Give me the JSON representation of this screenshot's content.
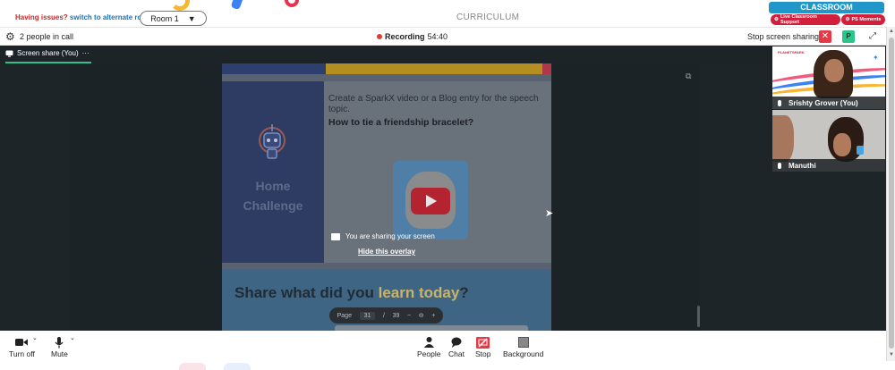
{
  "topbar": {
    "issues_text": "Having issues?",
    "switch_link": "switch to alternate room",
    "room_label": "Room 1",
    "room_arrow": "▼",
    "curriculum": "CURRICULUM",
    "classroom_badge": "CLASSROOM",
    "live_support": "Live Classroom Support",
    "ps_moments": "PS Moments"
  },
  "callbar": {
    "people_in_call": "2 people in call",
    "recording_label": "Recording",
    "recording_time": "54:40",
    "stop_sharing": "Stop screen sharing",
    "close_symbol": "✕",
    "p_badge": "P",
    "fullscreen_symbol": "⤢"
  },
  "stage": {
    "tab_label": "Screen share (You)",
    "tab_more": "···",
    "overlay_title": "You are sharing your screen",
    "overlay_hide": "Hide this overlay"
  },
  "shared_document": {
    "home_challenge_line1": "Home",
    "home_challenge_line2": "Challenge",
    "task_text": "Create a SparkX video or a Blog entry for the speech topic.",
    "question": "How to tie a friendship bracelet?",
    "share_prefix": "Share what did you ",
    "share_highlight": "learn today",
    "share_suffix": "?",
    "page_label": "Page",
    "page_current": "31",
    "page_sep": "/",
    "page_total": "39",
    "minus": "−",
    "zoom": "⊖",
    "plus": "+"
  },
  "participants": [
    {
      "name": "Srishty Grover (You)",
      "logo": "PLANETSPARK"
    },
    {
      "name": "Manuthi"
    }
  ],
  "toolbar": {
    "turn_off": "Turn off",
    "mute": "Mute",
    "people": "People",
    "chat": "Chat",
    "stop": "Stop",
    "background": "Background"
  },
  "colors": {
    "accent_green": "#2bc48a",
    "recording_red": "#e53935",
    "brand_red": "#d41f3c",
    "classroom_blue": "#2196c9",
    "stage_dark": "#1e2529"
  },
  "icons": {
    "settings": "gear-icon",
    "recording": "recording-dot-icon",
    "camera": "camera-icon",
    "mic": "microphone-icon",
    "people": "people-icon",
    "chat": "chat-icon",
    "stop": "stop-share-icon",
    "background": "background-icon"
  }
}
